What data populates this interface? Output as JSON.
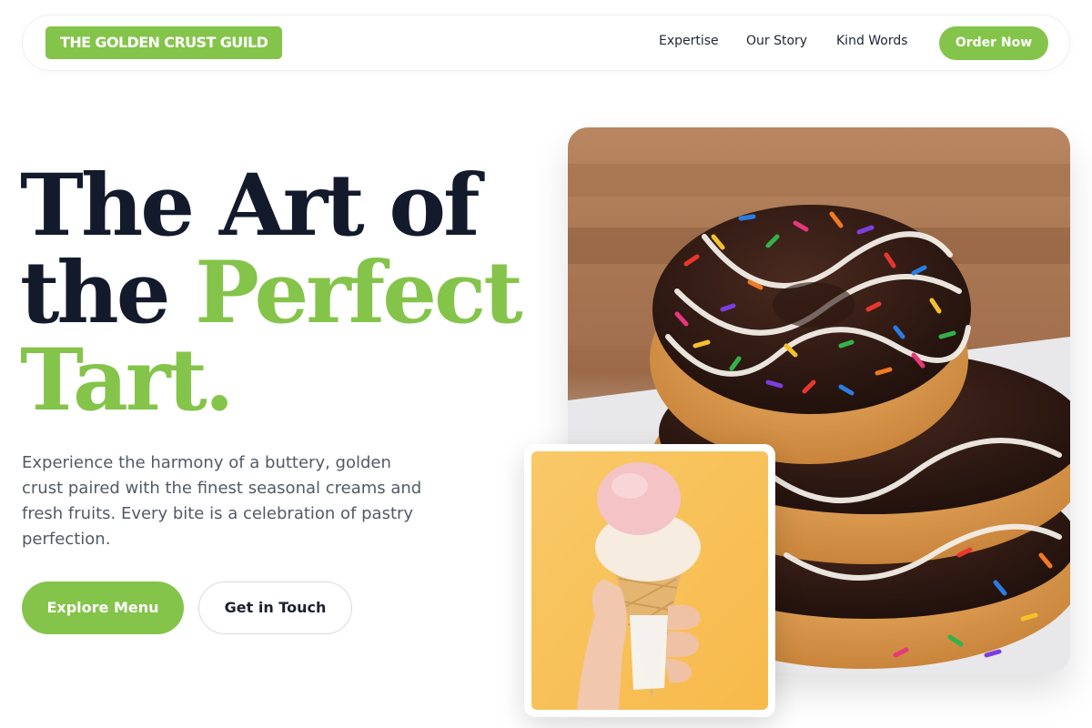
{
  "nav": {
    "brand": "THE GOLDEN CRUST GUILD",
    "links": [
      "Expertise",
      "Our Story",
      "Kind Words"
    ],
    "cta": "Order Now"
  },
  "hero": {
    "headline_line1": "The Art of",
    "headline_line2_dark": "the ",
    "headline_line2_accent": "Perfect",
    "headline_line3": "Tart.",
    "lede": "Experience the harmony of a buttery, golden crust paired with the finest seasonal creams and fresh fruits. Every bite is a celebration of pastry perfection.",
    "primary_button": "Explore Menu",
    "secondary_button": "Get in Touch"
  },
  "images": {
    "main": "donut-stack-photo",
    "secondary": "ice-cream-cone-photo"
  },
  "colors": {
    "accent": "#84c44a",
    "heading": "#131a2b",
    "body_text": "#535a66"
  }
}
